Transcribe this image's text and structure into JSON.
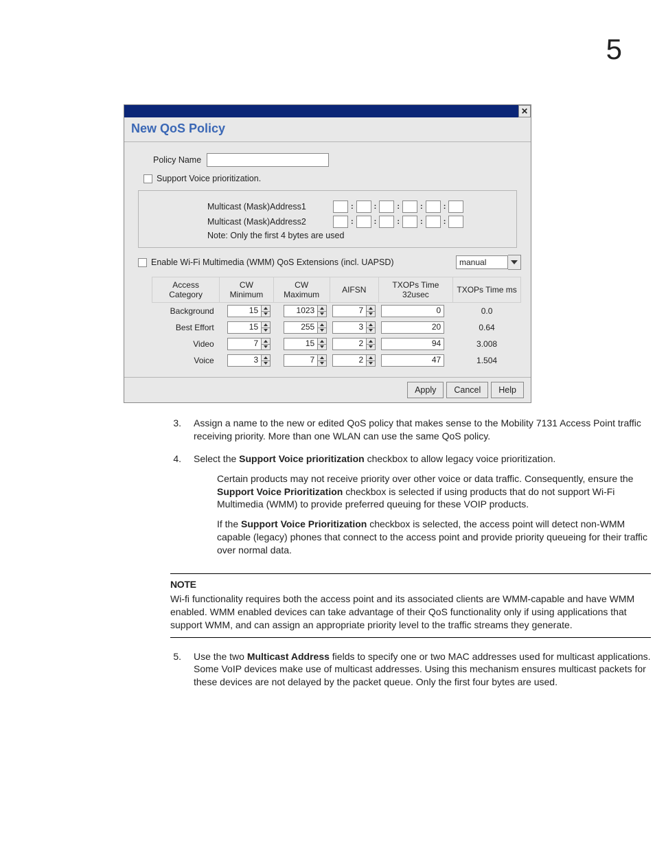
{
  "page": {
    "chapter": "5"
  },
  "dialog": {
    "heading": "New QoS Policy",
    "policy_name_label": "Policy Name",
    "policy_name_value": "",
    "support_voice_label": "Support Voice prioritization.",
    "multicast1_label": "Multicast (Mask)Address1",
    "multicast2_label": "Multicast (Mask)Address2",
    "multicast_note": "Note: Only the first 4 bytes are used",
    "wmm_label": "Enable Wi-Fi Multimedia (WMM) QoS Extensions (incl. UAPSD)",
    "wmm_combo": "manual",
    "headers": {
      "access": "Access Category",
      "cwmin": "CW Minimum",
      "cwmax": "CW Maximum",
      "aifsn": "AIFSN",
      "txops32": "TXOPs Time 32usec",
      "txopsms": "TXOPs Time ms"
    },
    "rows": [
      {
        "label": "Background",
        "cwmin": "15",
        "cwmax": "1023",
        "aifsn": "7",
        "txops32": "0",
        "txopsms": "0.0"
      },
      {
        "label": "Best Effort",
        "cwmin": "15",
        "cwmax": "255",
        "aifsn": "3",
        "txops32": "20",
        "txopsms": "0.64"
      },
      {
        "label": "Video",
        "cwmin": "7",
        "cwmax": "15",
        "aifsn": "2",
        "txops32": "94",
        "txopsms": "3.008"
      },
      {
        "label": "Voice",
        "cwmin": "3",
        "cwmax": "7",
        "aifsn": "2",
        "txops32": "47",
        "txopsms": "1.504"
      }
    ],
    "buttons": {
      "apply": "Apply",
      "cancel": "Cancel",
      "help": "Help"
    }
  },
  "step3": {
    "num": "3.",
    "text": "Assign a name to the new or edited QoS policy that makes sense to the Mobility 7131 Access Point traffic receiving priority. More than one WLAN can use the same QoS policy."
  },
  "step4": {
    "num": "4.",
    "lead_a": "Select the ",
    "bold_a": "Support Voice prioritization",
    "lead_b": " checkbox to allow legacy voice prioritization.",
    "para1_a": "Certain products may not receive priority over other voice or data traffic. Consequently, ensure the ",
    "para1_bold": "Support Voice Prioritization",
    "para1_b": " checkbox is selected if using products that do not support Wi-Fi Multimedia (WMM) to provide preferred queuing for these VOIP products.",
    "para2_a": "If the ",
    "para2_bold": "Support Voice Prioritization",
    "para2_b": " checkbox is selected, the access point will detect non-WMM capable (legacy) phones that connect to the access point and provide priority queueing for their traffic over normal data."
  },
  "note": {
    "label": "NOTE",
    "text": "Wi-fi functionality requires both the access point and its associated clients are WMM-capable and have WMM enabled. WMM enabled devices can take advantage of their QoS functionality only if using applications that support WMM, and can assign an appropriate priority level to the traffic streams they generate."
  },
  "step5": {
    "num": "5.",
    "lead_a": "Use the two ",
    "bold_a": "Multicast Address",
    "lead_b": " fields to specify one or two MAC addresses used for multicast applications. Some VoIP devices make use of multicast addresses. Using this mechanism ensures multicast packets for these devices are not delayed by the packet queue. Only the first four bytes are used."
  }
}
